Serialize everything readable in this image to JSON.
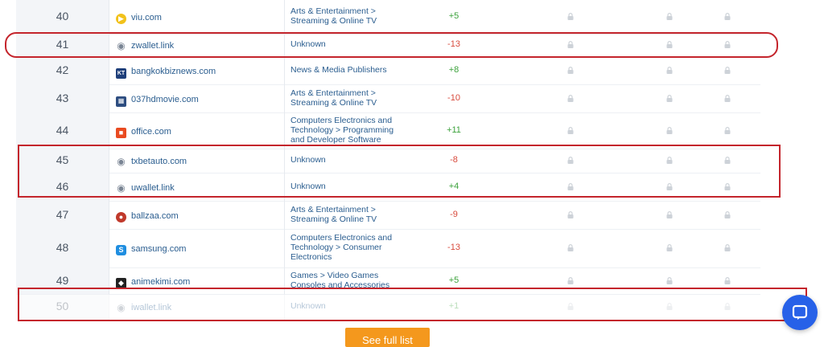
{
  "rows": [
    {
      "rank": "40",
      "site": "viu.com",
      "icon": "viu-logo-icon",
      "category": "Arts & Entertainment > Streaming & Online TV",
      "change": "+5",
      "sign": "pos"
    },
    {
      "rank": "41",
      "site": "zwallet.link",
      "icon": "globe-icon",
      "category": "Unknown",
      "change": "-13",
      "sign": "neg"
    },
    {
      "rank": "42",
      "site": "bangkokbiznews.com",
      "icon": "bangkokbiznews-logo-icon",
      "category": "News & Media Publishers",
      "change": "+8",
      "sign": "pos"
    },
    {
      "rank": "43",
      "site": "037hdmovie.com",
      "icon": "film-icon",
      "category": "Arts & Entertainment > Streaming & Online TV",
      "change": "-10",
      "sign": "neg"
    },
    {
      "rank": "44",
      "site": "office.com",
      "icon": "office-logo-icon",
      "category": "Computers Electronics and Technology > Programming and Developer Software",
      "change": "+11",
      "sign": "pos"
    },
    {
      "rank": "45",
      "site": "txbetauto.com",
      "icon": "globe-icon",
      "category": "Unknown",
      "change": "-8",
      "sign": "neg"
    },
    {
      "rank": "46",
      "site": "uwallet.link",
      "icon": "globe-icon",
      "category": "Unknown",
      "change": "+4",
      "sign": "pos"
    },
    {
      "rank": "47",
      "site": "ballzaa.com",
      "icon": "ballzaa-logo-icon",
      "category": "Arts & Entertainment > Streaming & Online TV",
      "change": "-9",
      "sign": "neg"
    },
    {
      "rank": "48",
      "site": "samsung.com",
      "icon": "samsung-logo-icon",
      "category": "Computers Electronics and Technology > Consumer Electronics",
      "change": "-13",
      "sign": "neg"
    },
    {
      "rank": "49",
      "site": "animekimi.com",
      "icon": "animekimi-logo-icon",
      "category": "Games > Video Games Consoles and Accessories",
      "change": "+5",
      "sign": "pos"
    },
    {
      "rank": "50",
      "site": "iwallet.link",
      "icon": "globe-icon",
      "category": "Unknown",
      "change": "+1",
      "sign": "pos"
    }
  ],
  "lock_icon": "lock-icon",
  "see_full_list_label": "See full list",
  "chat_icon": "chat-bubble-icon",
  "colors": {
    "highlight": "#c4252c",
    "button": "#f4981d",
    "chat": "#2761e8",
    "link": "#2a5d8f",
    "positive": "#3ca23c",
    "negative": "#d84a3c"
  }
}
